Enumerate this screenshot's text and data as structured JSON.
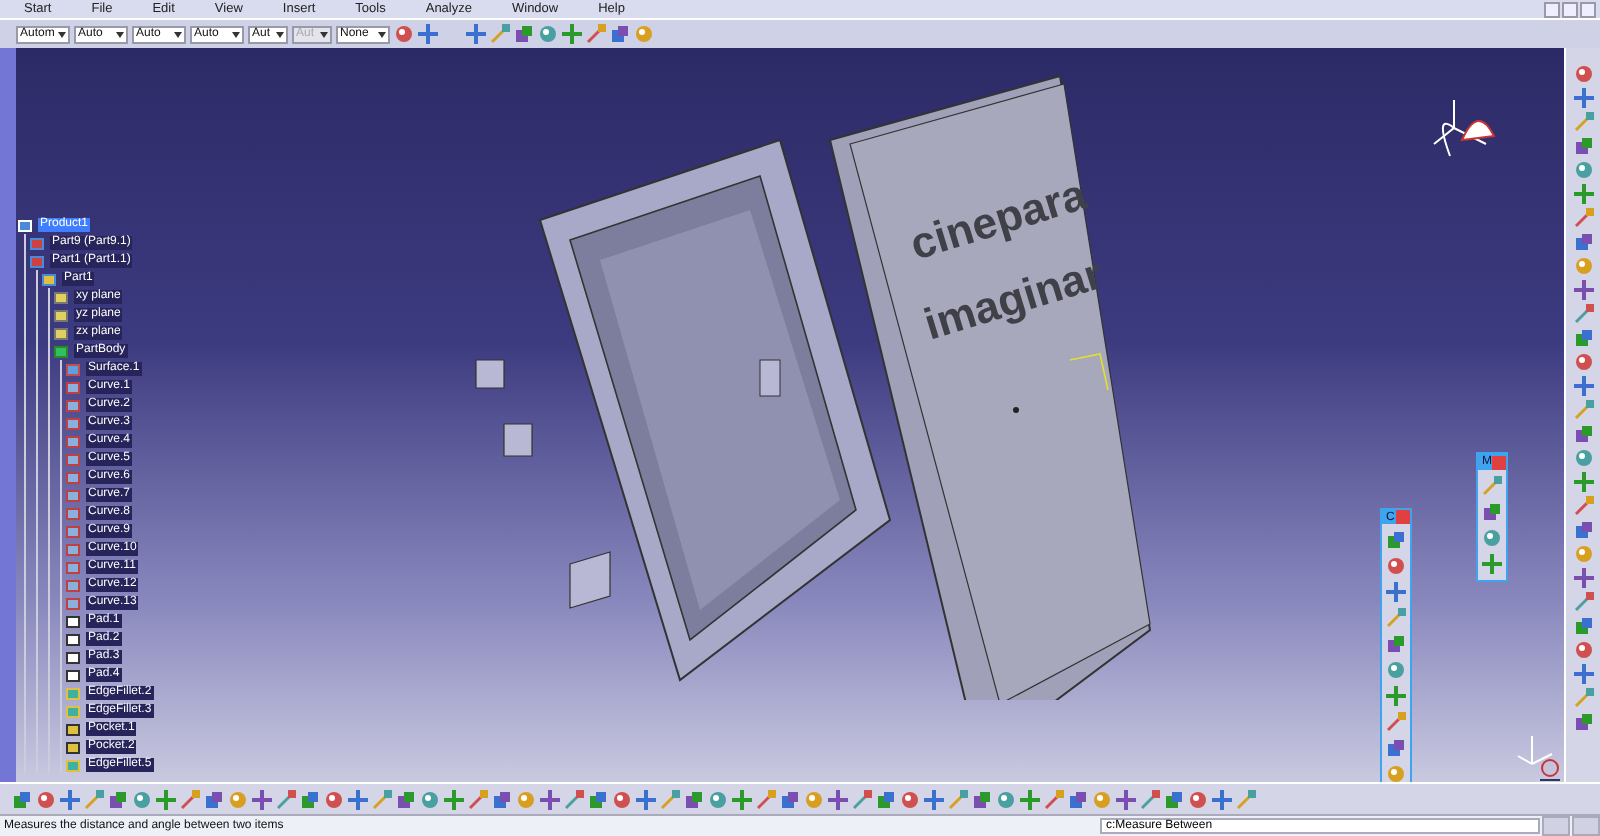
{
  "menu": [
    {
      "label": "Start"
    },
    {
      "label": "File"
    },
    {
      "label": "Edit"
    },
    {
      "label": "View"
    },
    {
      "label": "Insert"
    },
    {
      "label": "Tools"
    },
    {
      "label": "Analyze"
    },
    {
      "label": "Window"
    },
    {
      "label": "Help"
    }
  ],
  "toolbar": {
    "dropdowns": [
      {
        "value": "Autom",
        "disabled": false
      },
      {
        "value": "Auto",
        "disabled": false
      },
      {
        "value": "Auto",
        "disabled": false
      },
      {
        "value": "Auto",
        "disabled": false
      },
      {
        "value": "Aut",
        "disabled": false
      },
      {
        "value": "Aut",
        "disabled": true
      },
      {
        "value": "None",
        "disabled": false
      }
    ]
  },
  "tree": {
    "items": [
      {
        "label": "Product1",
        "kind": "product",
        "selected": true,
        "children": [
          {
            "label": "Part9 (Part9.1)",
            "kind": "part",
            "selected": false
          },
          {
            "label": "Part1 (Part1.1)",
            "kind": "part",
            "selected": false,
            "children": [
              {
                "label": "Part1",
                "kind": "partdoc",
                "selected": false,
                "children": [
                  {
                    "label": "xy plane",
                    "kind": "plane",
                    "selected": false
                  },
                  {
                    "label": "yz plane",
                    "kind": "plane",
                    "selected": false
                  },
                  {
                    "label": "zx plane",
                    "kind": "plane",
                    "selected": false
                  },
                  {
                    "label": "PartBody",
                    "kind": "body",
                    "selected": false,
                    "children": [
                      {
                        "label": "Surface.1",
                        "kind": "surface",
                        "selected": false
                      },
                      {
                        "label": "Curve.1",
                        "kind": "curve",
                        "selected": false
                      },
                      {
                        "label": "Curve.2",
                        "kind": "curve",
                        "selected": false
                      },
                      {
                        "label": "Curve.3",
                        "kind": "curve",
                        "selected": false
                      },
                      {
                        "label": "Curve.4",
                        "kind": "curve",
                        "selected": false
                      },
                      {
                        "label": "Curve.5",
                        "kind": "curve",
                        "selected": false
                      },
                      {
                        "label": "Curve.6",
                        "kind": "curve",
                        "selected": false
                      },
                      {
                        "label": "Curve.7",
                        "kind": "curve",
                        "selected": false
                      },
                      {
                        "label": "Curve.8",
                        "kind": "curve",
                        "selected": false
                      },
                      {
                        "label": "Curve.9",
                        "kind": "curve",
                        "selected": false
                      },
                      {
                        "label": "Curve.10",
                        "kind": "curve",
                        "selected": false
                      },
                      {
                        "label": "Curve.11",
                        "kind": "curve",
                        "selected": false
                      },
                      {
                        "label": "Curve.12",
                        "kind": "curve",
                        "selected": false
                      },
                      {
                        "label": "Curve.13",
                        "kind": "curve",
                        "selected": false
                      },
                      {
                        "label": "Pad.1",
                        "kind": "pad",
                        "selected": false
                      },
                      {
                        "label": "Pad.2",
                        "kind": "pad",
                        "selected": false
                      },
                      {
                        "label": "Pad.3",
                        "kind": "pad",
                        "selected": false
                      },
                      {
                        "label": "Pad.4",
                        "kind": "pad",
                        "selected": false
                      },
                      {
                        "label": "EdgeFillet.2",
                        "kind": "fillet",
                        "selected": false
                      },
                      {
                        "label": "EdgeFillet.3",
                        "kind": "fillet",
                        "selected": false
                      },
                      {
                        "label": "Pocket.1",
                        "kind": "pocket",
                        "selected": false
                      },
                      {
                        "label": "Pocket.2",
                        "kind": "pocket",
                        "selected": false
                      },
                      {
                        "label": "EdgeFillet.5",
                        "kind": "fillet",
                        "selected": false
                      }
                    ]
                  }
                ]
              }
            ]
          }
        ]
      }
    ]
  },
  "model": {
    "engraved_text": [
      "cinepara",
      "imaginar"
    ]
  },
  "floating_toolbars": [
    {
      "title": "C"
    },
    {
      "title": "M"
    }
  ],
  "status_bar": {
    "message": "Measures the distance and angle between two items",
    "command": "c:Measure Between"
  }
}
